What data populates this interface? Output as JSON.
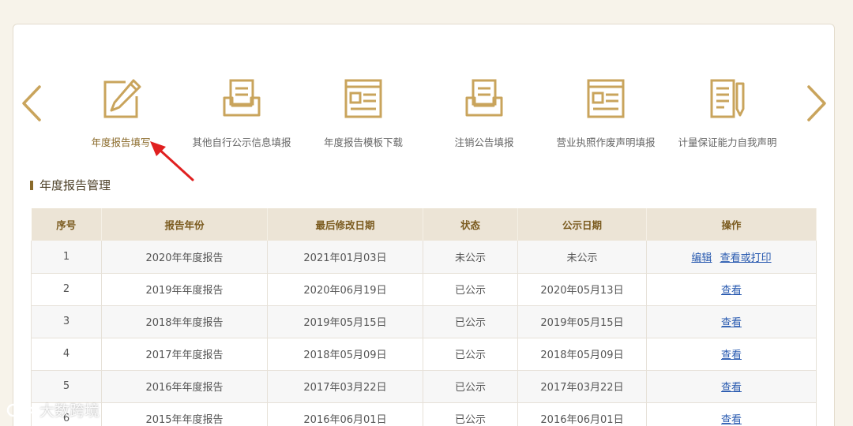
{
  "shortcuts": [
    {
      "label": "年度报告填写",
      "icon": "edit-form-icon",
      "active": true
    },
    {
      "label": "其他自行公示信息填报",
      "icon": "inbox-tray-icon"
    },
    {
      "label": "年度报告模板下载",
      "icon": "template-doc-icon"
    },
    {
      "label": "注销公告填报",
      "icon": "inbox-tray-icon"
    },
    {
      "label": "营业执照作废声明填报",
      "icon": "template-doc-icon"
    },
    {
      "label": "计量保证能力自我声明",
      "icon": "checklist-pen-icon"
    }
  ],
  "section": {
    "title": "年度报告管理"
  },
  "table": {
    "headers": [
      "序号",
      "报告年份",
      "最后修改日期",
      "状态",
      "公示日期",
      "操作"
    ],
    "rows": [
      {
        "no": "1",
        "year": "2020年年度报告",
        "modified": "2021年01月03日",
        "status": "未公示",
        "published": "未公示",
        "actions": [
          "编辑",
          "查看或打印"
        ]
      },
      {
        "no": "2",
        "year": "2019年年度报告",
        "modified": "2020年06月19日",
        "status": "已公示",
        "published": "2020年05月13日",
        "actions": [
          "查看"
        ]
      },
      {
        "no": "3",
        "year": "2018年年度报告",
        "modified": "2019年05月15日",
        "status": "已公示",
        "published": "2019年05月15日",
        "actions": [
          "查看"
        ]
      },
      {
        "no": "4",
        "year": "2017年年度报告",
        "modified": "2018年05月09日",
        "status": "已公示",
        "published": "2018年05月09日",
        "actions": [
          "查看"
        ]
      },
      {
        "no": "5",
        "year": "2016年年度报告",
        "modified": "2017年03月22日",
        "status": "已公示",
        "published": "2017年03月22日",
        "actions": [
          "查看"
        ]
      },
      {
        "no": "6",
        "year": "2015年年度报告",
        "modified": "2016年06月01日",
        "status": "已公示",
        "published": "2016年06月01日",
        "actions": [
          "查看"
        ]
      }
    ]
  },
  "watermark": {
    "text": "大数跨境"
  },
  "colors": {
    "accent": "#c9a45c",
    "accent_dark": "#8a6a2a",
    "header_bg": "#ece4d6",
    "link": "#2a5bb0",
    "pointer": "#e02020"
  }
}
